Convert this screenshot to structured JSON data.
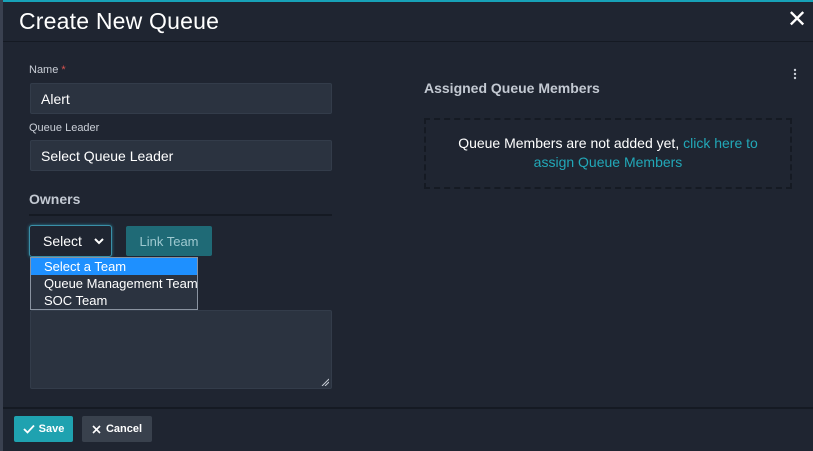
{
  "modal": {
    "title": "Create New Queue",
    "close_glyph": "✕"
  },
  "form": {
    "name": {
      "label": "Name",
      "required_mark": "*",
      "value": "Alert"
    },
    "queue_leader": {
      "label": "Queue Leader",
      "value": "Select Queue Leader"
    },
    "owners": {
      "title": "Owners",
      "select_value": "Select",
      "link_team_label": "Link Team",
      "dropdown_options": [
        "Select a Team",
        "Queue Management Team",
        "SOC Team"
      ],
      "highlighted_option_index": 0
    }
  },
  "members": {
    "title": "Assigned Queue Members",
    "empty_text": "Queue Members are not added yet,",
    "link_line1": "click here to",
    "link_line2": "assign Queue Members"
  },
  "footer": {
    "save_label": "Save",
    "cancel_label": "Cancel"
  },
  "colors": {
    "accent": "#17a2b8",
    "background": "#1f2531",
    "input_bg": "#2b3340",
    "highlight": "#1e90ff",
    "required": "#d9534f"
  },
  "icons": {
    "close": "close-icon",
    "save": "check-icon",
    "cancel": "x-icon",
    "select": "chevron-down-icon",
    "menu": "kebab-menu-icon",
    "resize": "resize-handle-icon"
  }
}
